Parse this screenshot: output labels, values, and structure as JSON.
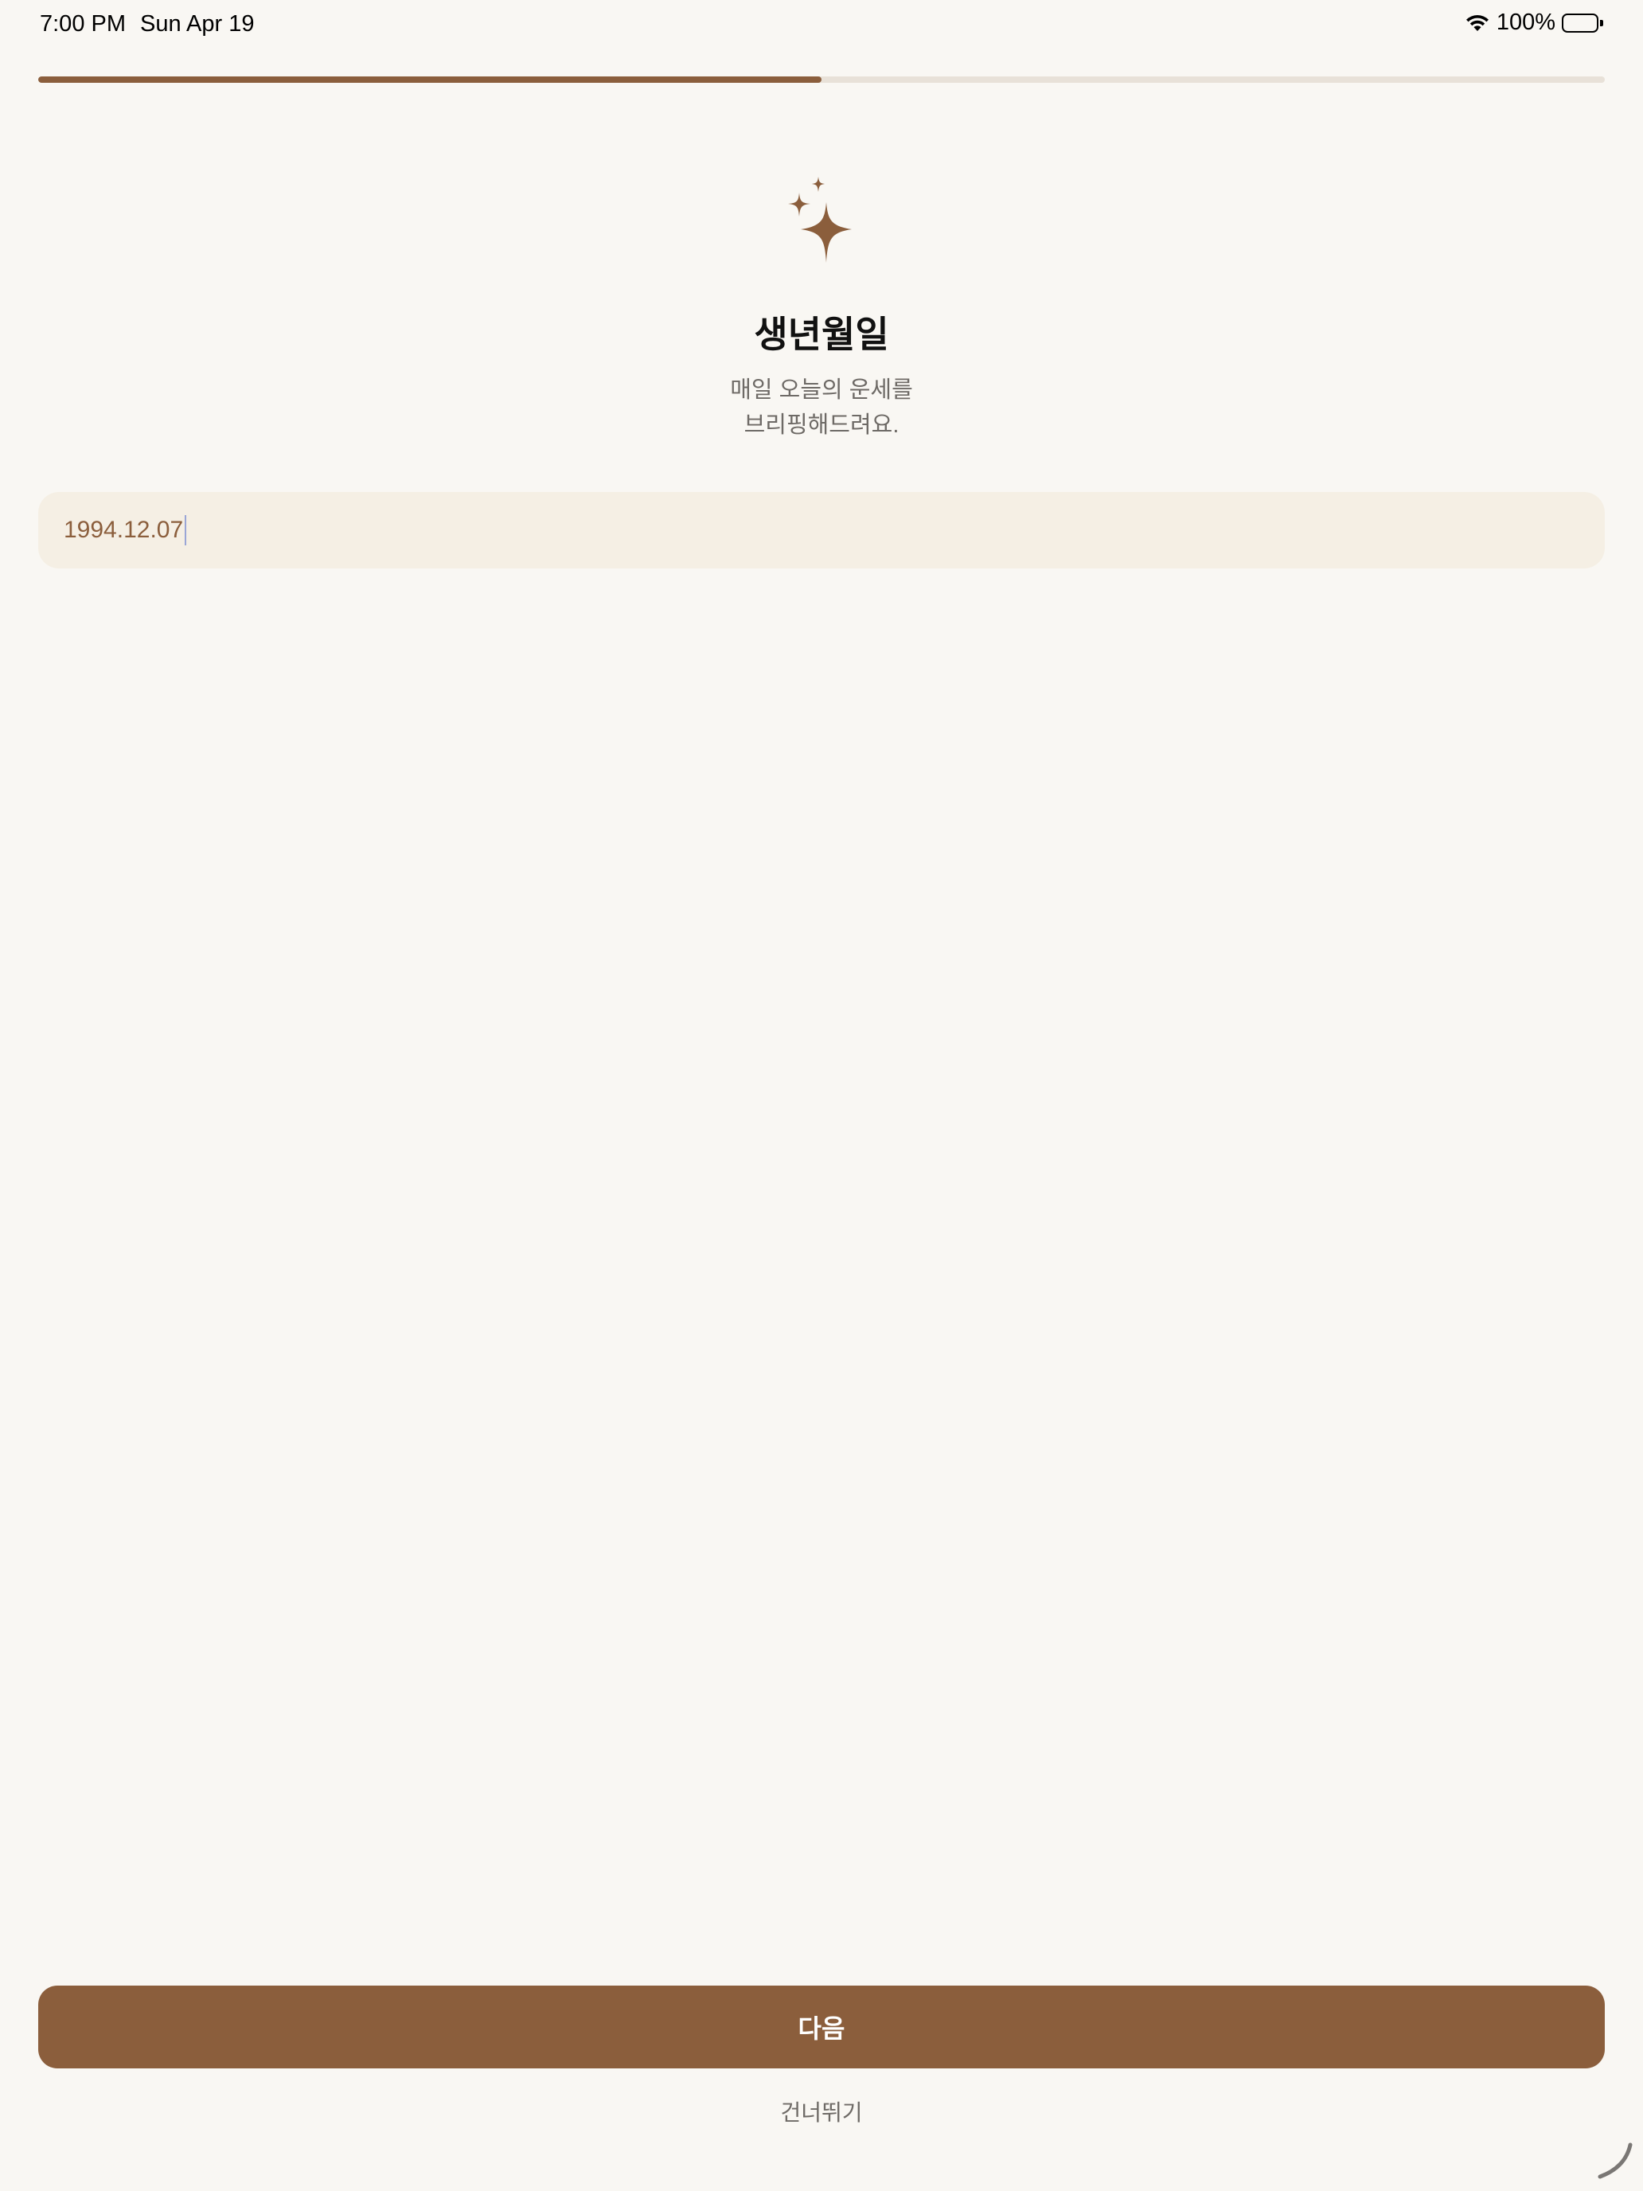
{
  "status_bar": {
    "time": "7:00 PM",
    "date": "Sun Apr 19",
    "battery_percent": "100%",
    "wifi_icon": "wifi-icon",
    "battery_icon": "battery-icon"
  },
  "progress": {
    "value": 0.5
  },
  "header": {
    "icon": "sparkles-icon",
    "title": "생년월일",
    "subtitle_line1": "매일 오늘의 운세를",
    "subtitle_line2": "브리핑해드려요."
  },
  "birthdate_field": {
    "value": "1994.12.07"
  },
  "actions": {
    "next_label": "다음",
    "skip_label": "건너뛰기"
  },
  "colors": {
    "background": "#f9f7f3",
    "accent": "#8b5e3c",
    "field_background": "#f5efe4",
    "progress_track": "#e8e1d8",
    "muted_text": "#6e6a66"
  }
}
